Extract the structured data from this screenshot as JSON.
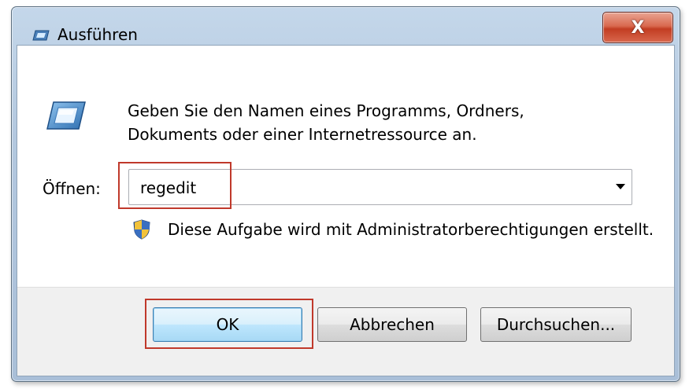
{
  "window": {
    "title": "Ausführen",
    "title_icon": "run-icon",
    "close_label": "X"
  },
  "content": {
    "icon": "run-icon",
    "description_line1": "Geben Sie den Namen eines Programms, Ordners,",
    "description_line2": "Dokuments oder einer Internetressource an.",
    "open_label": "Öffnen:",
    "open_value": "regedit",
    "admin_icon": "uac-shield-icon",
    "admin_note": "Diese Aufgabe wird mit Administratorberechtigungen erstellt."
  },
  "buttons": {
    "ok": "OK",
    "cancel": "Abbrechen",
    "browse": "Durchsuchen..."
  },
  "highlights": {
    "color": "#c0392b"
  }
}
